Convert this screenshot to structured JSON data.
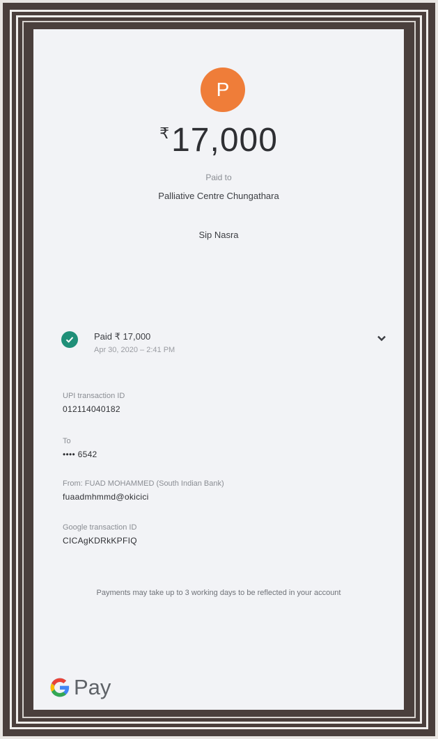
{
  "payee_initial": "P",
  "amount": {
    "currency_symbol": "₹",
    "value": "17,000"
  },
  "paid_to_label": "Paid to",
  "payee_name": "Palliative Centre Chungathara",
  "note": "Sip Nasra",
  "status": {
    "icon": "check-circle-icon",
    "title": "Paid ₹ 17,000",
    "datetime": "Apr 30, 2020 – 2:41 PM",
    "expand_icon": "chevron-down-icon"
  },
  "details": [
    {
      "label": "UPI transaction ID",
      "value": "012114040182"
    },
    {
      "label": "To",
      "value": "•••• 6542"
    },
    {
      "label": "From: FUAD MOHAMMED (South Indian Bank)",
      "value": "fuaadmhmmd@okicici"
    },
    {
      "label": "Google transaction ID",
      "value": "CICAgKDRkKPFIQ"
    }
  ],
  "footnote": "Payments may take up to 3 working days to be reflected in your account",
  "brand": {
    "logo_icon": "google-g-icon",
    "text": "Pay"
  },
  "colors": {
    "avatar": "#ef7d39",
    "success": "#1f8f78",
    "frame": "#4a3f3c"
  }
}
